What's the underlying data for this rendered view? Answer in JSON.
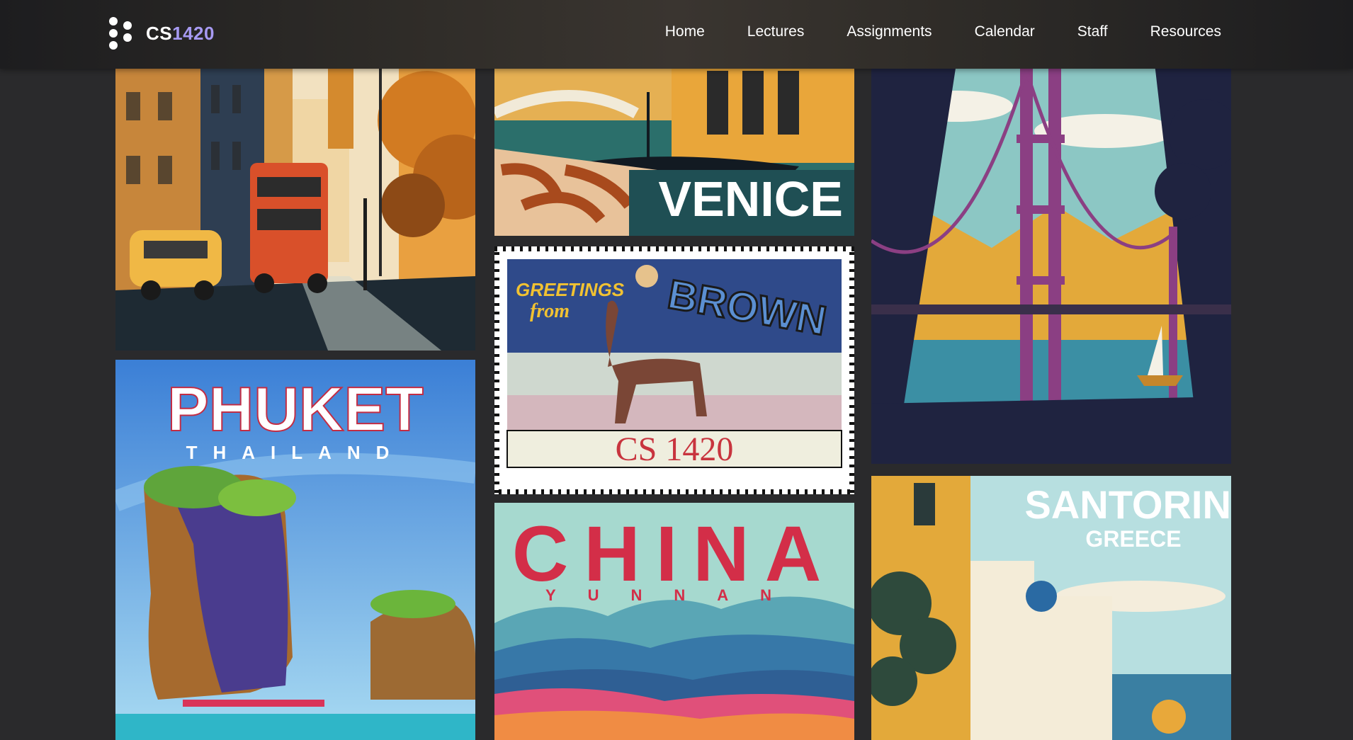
{
  "brand": {
    "prefix": "CS",
    "number": "1420"
  },
  "nav": [
    "Home",
    "Lectures",
    "Assignments",
    "Calendar",
    "Staff",
    "Resources"
  ],
  "posters": {
    "venice": {
      "title": "VENICE"
    },
    "stamp": {
      "greeting1": "GREETINGS",
      "greeting2": "from",
      "place": "BROWN",
      "course": "CS 1420"
    },
    "phuket": {
      "title": "PHUKET",
      "subtitle": "THAILAND"
    },
    "china": {
      "title": "CHINA",
      "subtitle": "YUNNAN"
    },
    "santorini": {
      "title": "SANTORINI",
      "subtitle": "GREECE"
    }
  }
}
